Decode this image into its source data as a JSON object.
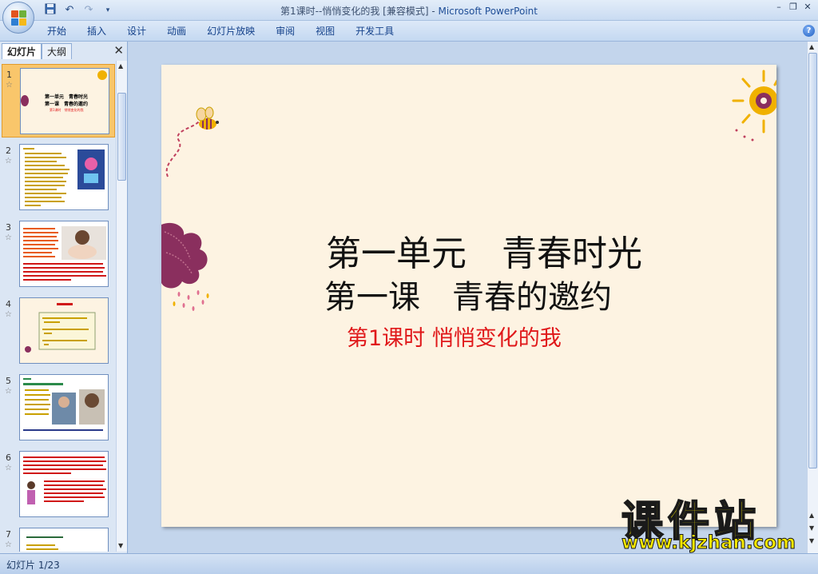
{
  "window": {
    "title": "第1课时--悄悄变化的我 [兼容模式] - ",
    "app_name": "Microsoft PowerPoint"
  },
  "quick_access": [
    "save-icon",
    "undo-icon",
    "redo-icon",
    "customize-icon"
  ],
  "ribbon": {
    "tabs": [
      "开始",
      "插入",
      "设计",
      "动画",
      "幻灯片放映",
      "审阅",
      "视图",
      "开发工具"
    ]
  },
  "left_pane": {
    "tabs": [
      "幻灯片",
      "大纲"
    ],
    "active_tab": "幻灯片",
    "thumbnails": [
      {
        "number": "1",
        "lines": [
          "第一单元　青春时光",
          "第一课　青春的邀约",
          "第1课时　悄悄变化的我"
        ]
      },
      {
        "number": "2"
      },
      {
        "number": "3"
      },
      {
        "number": "4"
      },
      {
        "number": "5"
      },
      {
        "number": "6"
      },
      {
        "number": "7"
      }
    ],
    "selected": 1
  },
  "slide": {
    "title_line1": "第一单元　青春时光",
    "title_line2": "第一课　青春的邀约",
    "subtitle": "第1课时  悄悄变化的我"
  },
  "watermark": {
    "line1": "课件站",
    "line2": "www.kjzhan.com"
  },
  "status": {
    "slide_indicator": "幻灯片 1/23"
  },
  "colors": {
    "slide_bg": "#fdf3e2",
    "subtitle": "#e0181a",
    "flower": "#8a2f5e",
    "sun": "#f0b100"
  }
}
